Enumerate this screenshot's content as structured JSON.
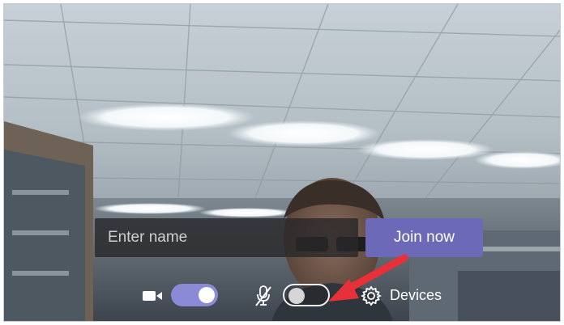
{
  "name_field": {
    "placeholder": "Enter name",
    "value": ""
  },
  "join_button": {
    "label": "Join now",
    "color": "#6b69b8"
  },
  "controls": {
    "video_toggle": {
      "state": "on",
      "icon": "video-camera-icon",
      "color": "#8b8ad6"
    },
    "mic_toggle": {
      "state": "off",
      "icon": "mic-muted-icon"
    },
    "devices": {
      "icon": "gear-icon",
      "label": "Devices"
    }
  },
  "annotation": {
    "icon": "red-arrow-icon",
    "color": "#e8303a"
  }
}
